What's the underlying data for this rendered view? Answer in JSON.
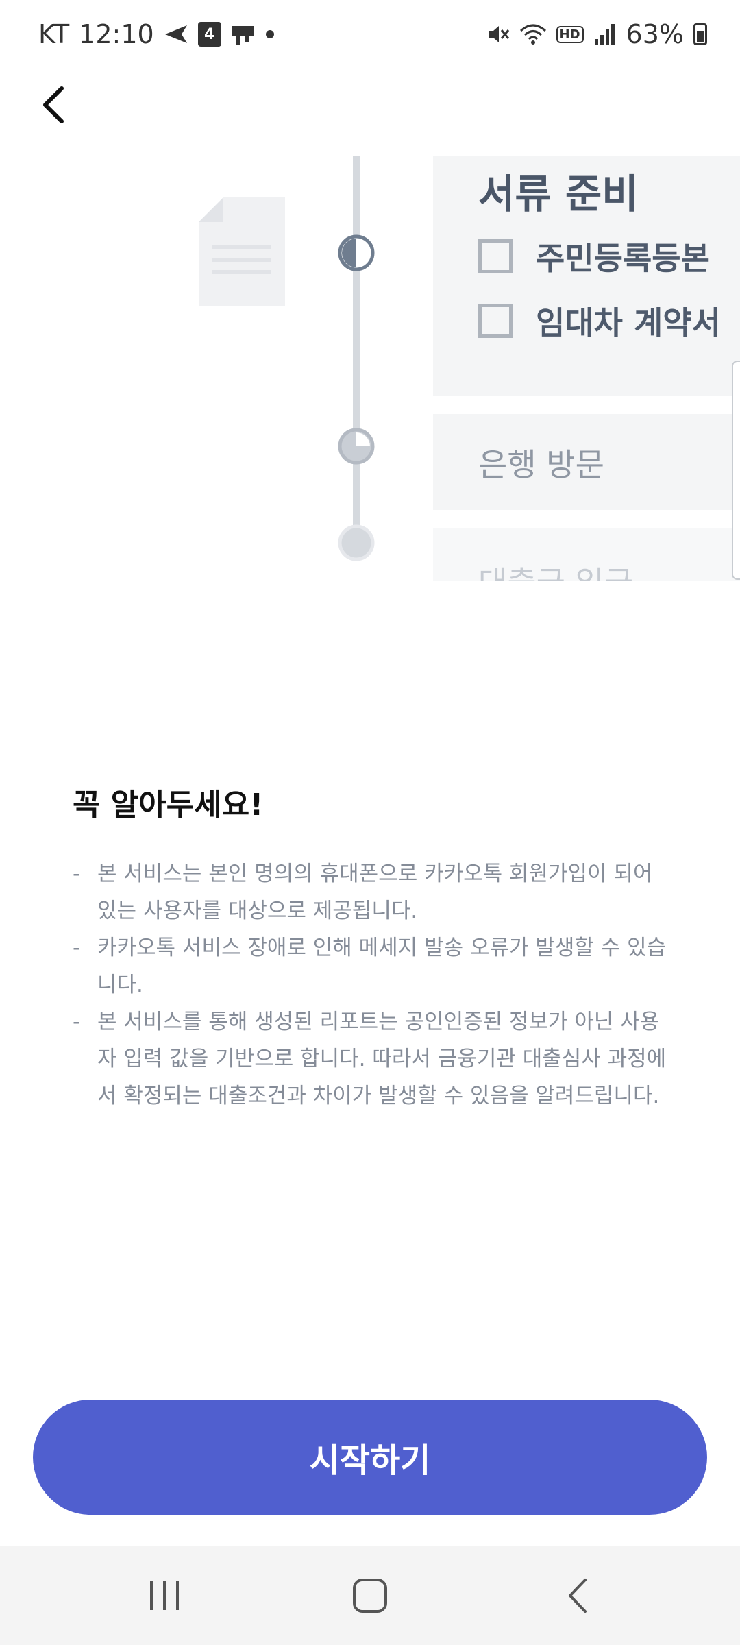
{
  "status_bar": {
    "carrier": "KT",
    "time": "12:10",
    "calendar_day": "4",
    "battery": "63%"
  },
  "timeline": {
    "card1_title": "서류 준비",
    "documents": [
      "주민등록등본",
      "임대차 계약서"
    ],
    "step2": "은행 방문",
    "step3": "대출금 입금"
  },
  "notice": {
    "title": "꼭 알아두세요!",
    "items": [
      "본 서비스는 본인 명의의 휴대폰으로 카카오톡 회원가입이 되어 있는 사용자를 대상으로 제공됩니다.",
      "카카오톡 서비스 장애로 인해 메세지 발송 오류가 발생할 수 있습니다.",
      "본 서비스를 통해 생성된 리포트는 공인인증된 정보가 아닌 사용자 입력 값을 기반으로 합니다. 따라서 금융기관 대출심사 과정에서 확정되는 대출조건과 차이가 발생할 수 있음을 알려드립니다."
    ]
  },
  "start_button": "시작하기",
  "colors": {
    "primary": "#505fcf",
    "card_bg": "#f4f5f6",
    "timeline": "#d5d9de",
    "node_active": "#6f7d8f"
  },
  "icons": {
    "back": "back-arrow-icon",
    "document": "document-icon",
    "nav_recent": "recent-apps-icon",
    "nav_home": "home-icon",
    "nav_back": "nav-back-icon"
  }
}
